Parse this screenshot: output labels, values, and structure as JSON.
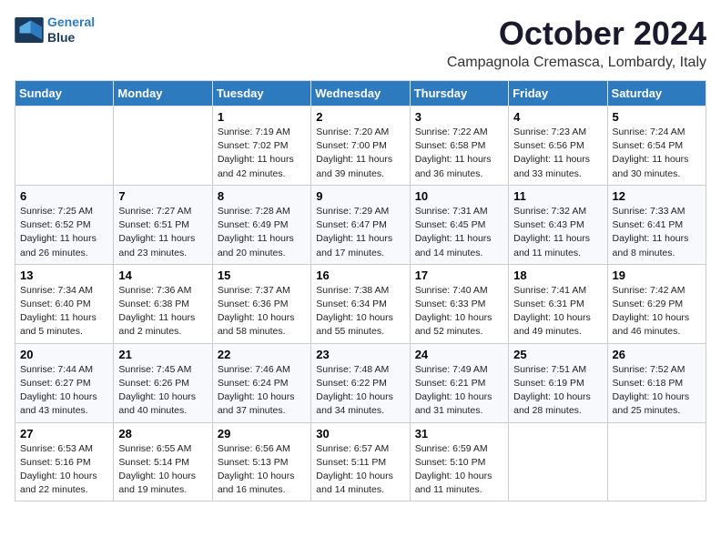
{
  "header": {
    "logo_line1": "General",
    "logo_line2": "Blue",
    "month": "October 2024",
    "location": "Campagnola Cremasca, Lombardy, Italy"
  },
  "weekdays": [
    "Sunday",
    "Monday",
    "Tuesday",
    "Wednesday",
    "Thursday",
    "Friday",
    "Saturday"
  ],
  "weeks": [
    [
      {
        "day": "",
        "info": ""
      },
      {
        "day": "",
        "info": ""
      },
      {
        "day": "1",
        "info": "Sunrise: 7:19 AM\nSunset: 7:02 PM\nDaylight: 11 hours and 42 minutes."
      },
      {
        "day": "2",
        "info": "Sunrise: 7:20 AM\nSunset: 7:00 PM\nDaylight: 11 hours and 39 minutes."
      },
      {
        "day": "3",
        "info": "Sunrise: 7:22 AM\nSunset: 6:58 PM\nDaylight: 11 hours and 36 minutes."
      },
      {
        "day": "4",
        "info": "Sunrise: 7:23 AM\nSunset: 6:56 PM\nDaylight: 11 hours and 33 minutes."
      },
      {
        "day": "5",
        "info": "Sunrise: 7:24 AM\nSunset: 6:54 PM\nDaylight: 11 hours and 30 minutes."
      }
    ],
    [
      {
        "day": "6",
        "info": "Sunrise: 7:25 AM\nSunset: 6:52 PM\nDaylight: 11 hours and 26 minutes."
      },
      {
        "day": "7",
        "info": "Sunrise: 7:27 AM\nSunset: 6:51 PM\nDaylight: 11 hours and 23 minutes."
      },
      {
        "day": "8",
        "info": "Sunrise: 7:28 AM\nSunset: 6:49 PM\nDaylight: 11 hours and 20 minutes."
      },
      {
        "day": "9",
        "info": "Sunrise: 7:29 AM\nSunset: 6:47 PM\nDaylight: 11 hours and 17 minutes."
      },
      {
        "day": "10",
        "info": "Sunrise: 7:31 AM\nSunset: 6:45 PM\nDaylight: 11 hours and 14 minutes."
      },
      {
        "day": "11",
        "info": "Sunrise: 7:32 AM\nSunset: 6:43 PM\nDaylight: 11 hours and 11 minutes."
      },
      {
        "day": "12",
        "info": "Sunrise: 7:33 AM\nSunset: 6:41 PM\nDaylight: 11 hours and 8 minutes."
      }
    ],
    [
      {
        "day": "13",
        "info": "Sunrise: 7:34 AM\nSunset: 6:40 PM\nDaylight: 11 hours and 5 minutes."
      },
      {
        "day": "14",
        "info": "Sunrise: 7:36 AM\nSunset: 6:38 PM\nDaylight: 11 hours and 2 minutes."
      },
      {
        "day": "15",
        "info": "Sunrise: 7:37 AM\nSunset: 6:36 PM\nDaylight: 10 hours and 58 minutes."
      },
      {
        "day": "16",
        "info": "Sunrise: 7:38 AM\nSunset: 6:34 PM\nDaylight: 10 hours and 55 minutes."
      },
      {
        "day": "17",
        "info": "Sunrise: 7:40 AM\nSunset: 6:33 PM\nDaylight: 10 hours and 52 minutes."
      },
      {
        "day": "18",
        "info": "Sunrise: 7:41 AM\nSunset: 6:31 PM\nDaylight: 10 hours and 49 minutes."
      },
      {
        "day": "19",
        "info": "Sunrise: 7:42 AM\nSunset: 6:29 PM\nDaylight: 10 hours and 46 minutes."
      }
    ],
    [
      {
        "day": "20",
        "info": "Sunrise: 7:44 AM\nSunset: 6:27 PM\nDaylight: 10 hours and 43 minutes."
      },
      {
        "day": "21",
        "info": "Sunrise: 7:45 AM\nSunset: 6:26 PM\nDaylight: 10 hours and 40 minutes."
      },
      {
        "day": "22",
        "info": "Sunrise: 7:46 AM\nSunset: 6:24 PM\nDaylight: 10 hours and 37 minutes."
      },
      {
        "day": "23",
        "info": "Sunrise: 7:48 AM\nSunset: 6:22 PM\nDaylight: 10 hours and 34 minutes."
      },
      {
        "day": "24",
        "info": "Sunrise: 7:49 AM\nSunset: 6:21 PM\nDaylight: 10 hours and 31 minutes."
      },
      {
        "day": "25",
        "info": "Sunrise: 7:51 AM\nSunset: 6:19 PM\nDaylight: 10 hours and 28 minutes."
      },
      {
        "day": "26",
        "info": "Sunrise: 7:52 AM\nSunset: 6:18 PM\nDaylight: 10 hours and 25 minutes."
      }
    ],
    [
      {
        "day": "27",
        "info": "Sunrise: 6:53 AM\nSunset: 5:16 PM\nDaylight: 10 hours and 22 minutes."
      },
      {
        "day": "28",
        "info": "Sunrise: 6:55 AM\nSunset: 5:14 PM\nDaylight: 10 hours and 19 minutes."
      },
      {
        "day": "29",
        "info": "Sunrise: 6:56 AM\nSunset: 5:13 PM\nDaylight: 10 hours and 16 minutes."
      },
      {
        "day": "30",
        "info": "Sunrise: 6:57 AM\nSunset: 5:11 PM\nDaylight: 10 hours and 14 minutes."
      },
      {
        "day": "31",
        "info": "Sunrise: 6:59 AM\nSunset: 5:10 PM\nDaylight: 10 hours and 11 minutes."
      },
      {
        "day": "",
        "info": ""
      },
      {
        "day": "",
        "info": ""
      }
    ]
  ]
}
